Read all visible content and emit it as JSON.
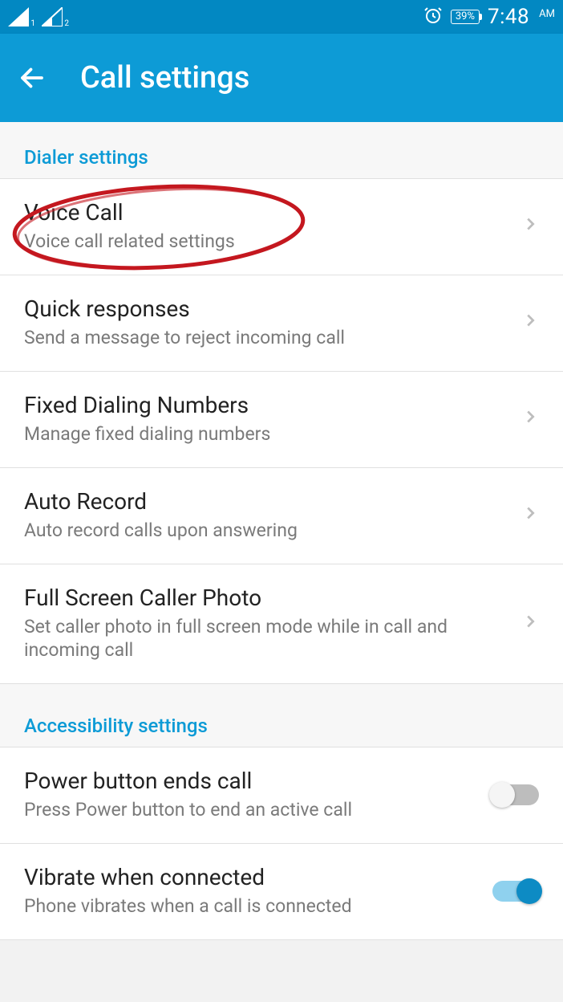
{
  "status": {
    "sim1": "1",
    "sim2": "2",
    "battery": "39%",
    "time": "7:48",
    "ampm": "AM"
  },
  "header": {
    "title": "Call settings"
  },
  "sections": {
    "dialer_header": "Dialer settings",
    "accessibility_header": "Accessibility settings"
  },
  "items": {
    "voice_call": {
      "title": "Voice Call",
      "sub": "Voice call related settings"
    },
    "quick_responses": {
      "title": "Quick responses",
      "sub": "Send a message to reject incoming call"
    },
    "fdn": {
      "title": "Fixed Dialing Numbers",
      "sub": "Manage fixed dialing numbers"
    },
    "auto_record": {
      "title": "Auto Record",
      "sub": "Auto record calls upon answering"
    },
    "full_photo": {
      "title": "Full Screen Caller Photo",
      "sub": "Set caller photo in full screen mode while in call and incoming call"
    },
    "power_end": {
      "title": "Power button ends call",
      "sub": "Press Power button to end an active call"
    },
    "vibrate": {
      "title": "Vibrate when connected",
      "sub": "Phone vibrates when a call is connected"
    }
  }
}
